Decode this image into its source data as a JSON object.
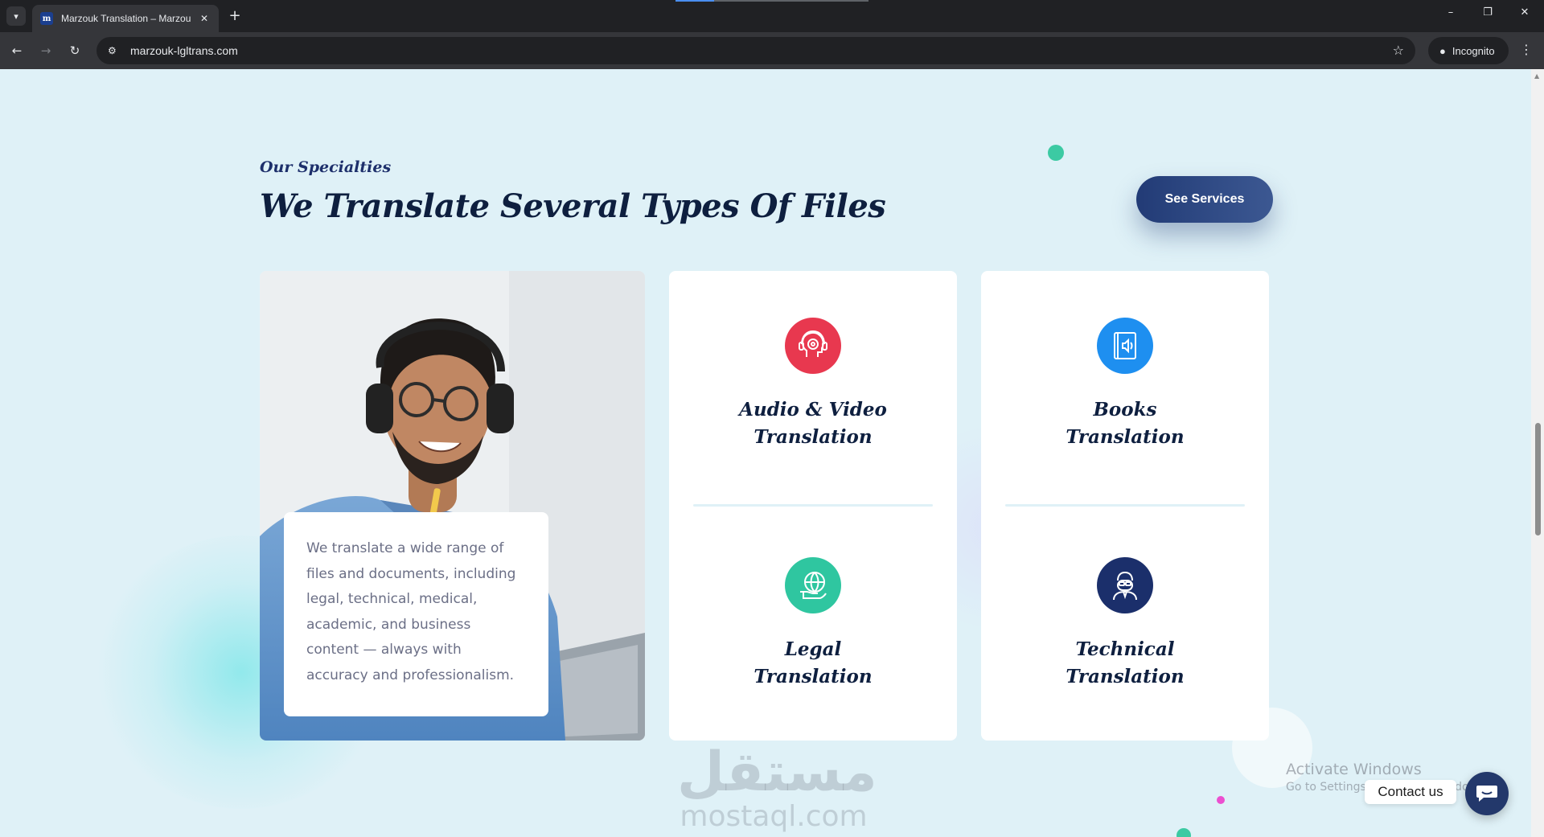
{
  "browser": {
    "tab_title": "Marzouk Translation – Marzouk",
    "tab_favicon_text": "m",
    "url": "marzouk-lgltrans.com",
    "incognito_label": "Incognito",
    "icons": {
      "tab_dropdown": "chevron-down-icon",
      "new_tab": "plus-icon",
      "back": "arrow-left-icon",
      "forward": "arrow-right-icon",
      "reload": "reload-icon",
      "site_info": "tune-icon",
      "bookmark": "star-icon",
      "menu": "kebab-icon"
    }
  },
  "section": {
    "eyebrow": "Our Specialties",
    "heading": "We Translate Several Types Of Files",
    "cta_label": "See Services",
    "description": "We translate a wide range of files and documents, including legal, technical, medical, academic, and business content — always with accuracy and professionalism."
  },
  "services": [
    {
      "line1": "Audio & Video",
      "line2": "Translation",
      "icon": "headset-head-icon",
      "color": "#e8384f"
    },
    {
      "line1": "Books",
      "line2": "Translation",
      "icon": "audiobook-icon",
      "color": "#1e8ff0"
    },
    {
      "line1": "Legal",
      "line2": "Translation",
      "icon": "globe-hand-icon",
      "color": "#2fc6a0"
    },
    {
      "line1": "Technical",
      "line2": "Translation",
      "icon": "engineer-icon",
      "color": "#1b2f6b"
    }
  ],
  "watermark": {
    "arabic": "مستقل",
    "latin": "mostaql.com"
  },
  "os_notice": {
    "line1": "Activate Windows",
    "line2": "Go to Settings to activate Windows."
  },
  "contact": {
    "label": "Contact us",
    "icon": "chat-icon"
  },
  "colors": {
    "accent_dark": "#223b76",
    "heading": "#0e1f3f",
    "page_bg": "#dff1f7"
  }
}
